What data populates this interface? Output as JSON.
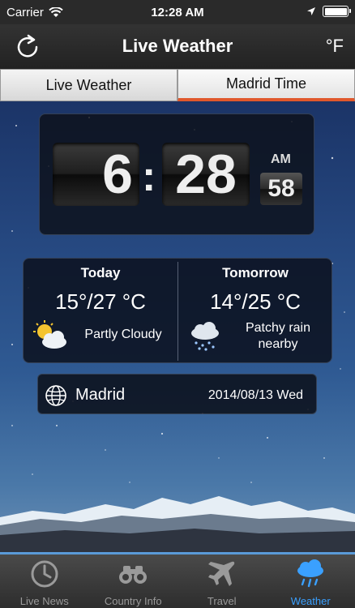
{
  "status_bar": {
    "carrier": "Carrier",
    "time": "12:28 AM"
  },
  "nav": {
    "title": "Live Weather",
    "unit_toggle": "°F"
  },
  "segments": [
    {
      "label": "Live Weather",
      "active": false
    },
    {
      "label": "Madrid Time",
      "active": true
    }
  ],
  "clock": {
    "hour": "6",
    "separator": ":",
    "minute": "28",
    "ampm": "AM",
    "second": "58"
  },
  "forecast": {
    "today": {
      "label": "Today",
      "temp": "15°/27 °C",
      "icon": "partly-cloudy-icon",
      "desc": "Partly Cloudy"
    },
    "tomorrow": {
      "label": "Tomorrow",
      "temp": "14°/25 °C",
      "icon": "rain-cloud-icon",
      "desc_line1": "Patchy rain",
      "desc_line2": "nearby"
    }
  },
  "location": {
    "city": "Madrid",
    "date": "2014/08/13 Wed"
  },
  "tabs": [
    {
      "label": "Live News",
      "icon": "clock-icon"
    },
    {
      "label": "Country Info",
      "icon": "binoculars-icon"
    },
    {
      "label": "Travel",
      "icon": "airplane-icon"
    },
    {
      "label": "Weather",
      "icon": "weather-icon",
      "active": true
    }
  ],
  "colors": {
    "accent": "#e0582c",
    "active_tab": "#3aa0ff"
  }
}
